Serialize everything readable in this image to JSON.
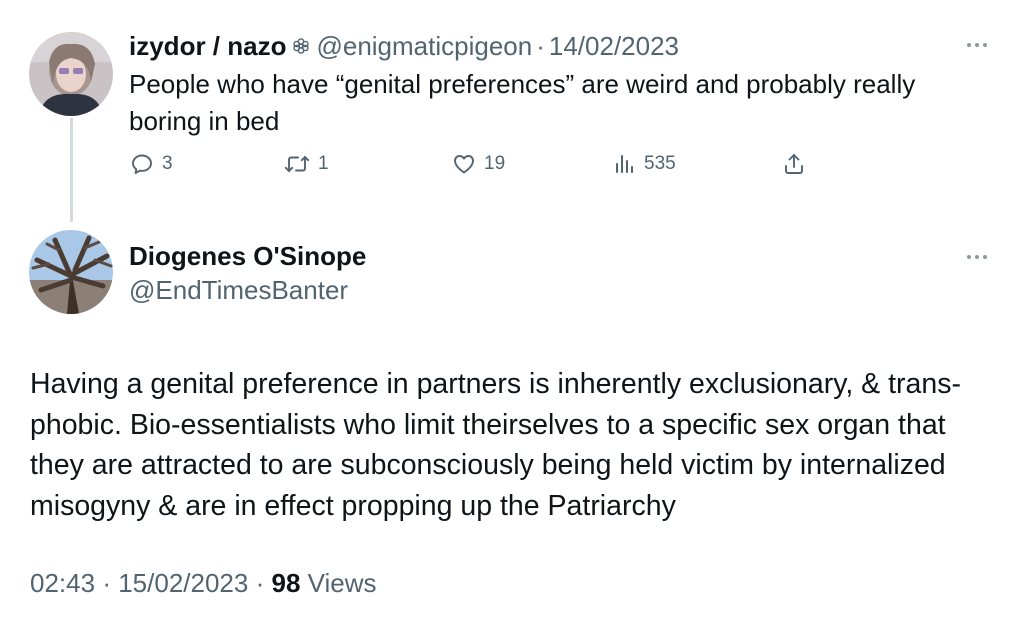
{
  "tweet_parent": {
    "display_name": "izydor / nazo",
    "handle": "@enigmaticpigeon",
    "separator": "·",
    "date": "14/02/2023",
    "text": "People who have “genital preferences” are weird and probably really boring in bed",
    "actions": {
      "replies": "3",
      "retweets": "1",
      "likes": "19",
      "views": "535"
    },
    "icons": {
      "verified": "flower-badge-icon",
      "reply": "reply-icon",
      "retweet": "retweet-icon",
      "like": "heart-icon",
      "views": "bar-chart-icon",
      "share": "share-icon",
      "more": "more-icon"
    }
  },
  "tweet_reply": {
    "display_name": "Diogenes O'Sinope",
    "handle": "@EndTimesBanter",
    "text": "Having a genital preference in partners is inherently exclusionary, & trans-phobic. Bio-essentialists who limit theirselves to a specific sex organ that they are attracted to are subconsciously being held victim by internalized misogyny & are in effect propping up the Patriarchy",
    "time": "02:43",
    "date": "15/02/2023",
    "separator": "·",
    "views_count": "98",
    "views_label": "Views"
  },
  "colors": {
    "text_primary": "#0f1419",
    "text_secondary": "#536471",
    "thread_line": "#cfd9de",
    "background": "#ffffff"
  }
}
